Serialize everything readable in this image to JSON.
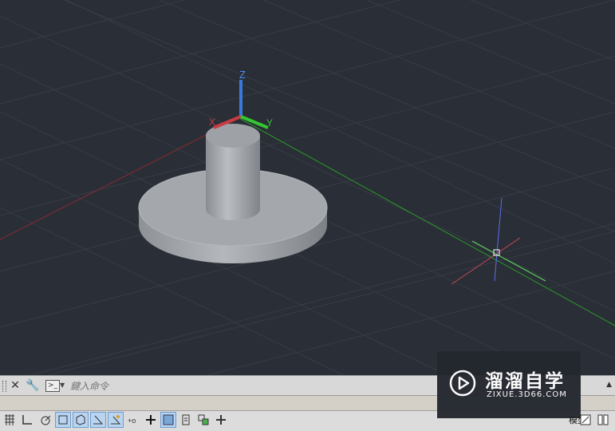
{
  "viewport": {
    "ucs_labels": {
      "x": "X",
      "y": "Y",
      "z": "Z"
    }
  },
  "command_line": {
    "close_icon": "close-icon",
    "settings_icon": "wrench-icon",
    "placeholder": "鍵入命令"
  },
  "status_bar": {
    "model_tab": "模型",
    "buttons": [
      "grid-icon",
      "snap-icon",
      "polar-icon",
      "osnap-icon",
      "3d-osnap-icon",
      "otrack-icon",
      "ducs-icon",
      "dyn-icon",
      "lineweight-icon",
      "transparency-icon",
      "qp-icon",
      "sc-icon",
      "am-icon"
    ]
  },
  "watermark": {
    "name": "溜溜自学",
    "site": "ZIXUE.3D66.COM"
  },
  "colors": {
    "viewport_bg": "#2a2e36",
    "grid_line": "#3a3f48",
    "x_axis": "#c83c46",
    "y_axis": "#32c832",
    "z_axis": "#3c78dc",
    "solid": "#a8acb0"
  }
}
